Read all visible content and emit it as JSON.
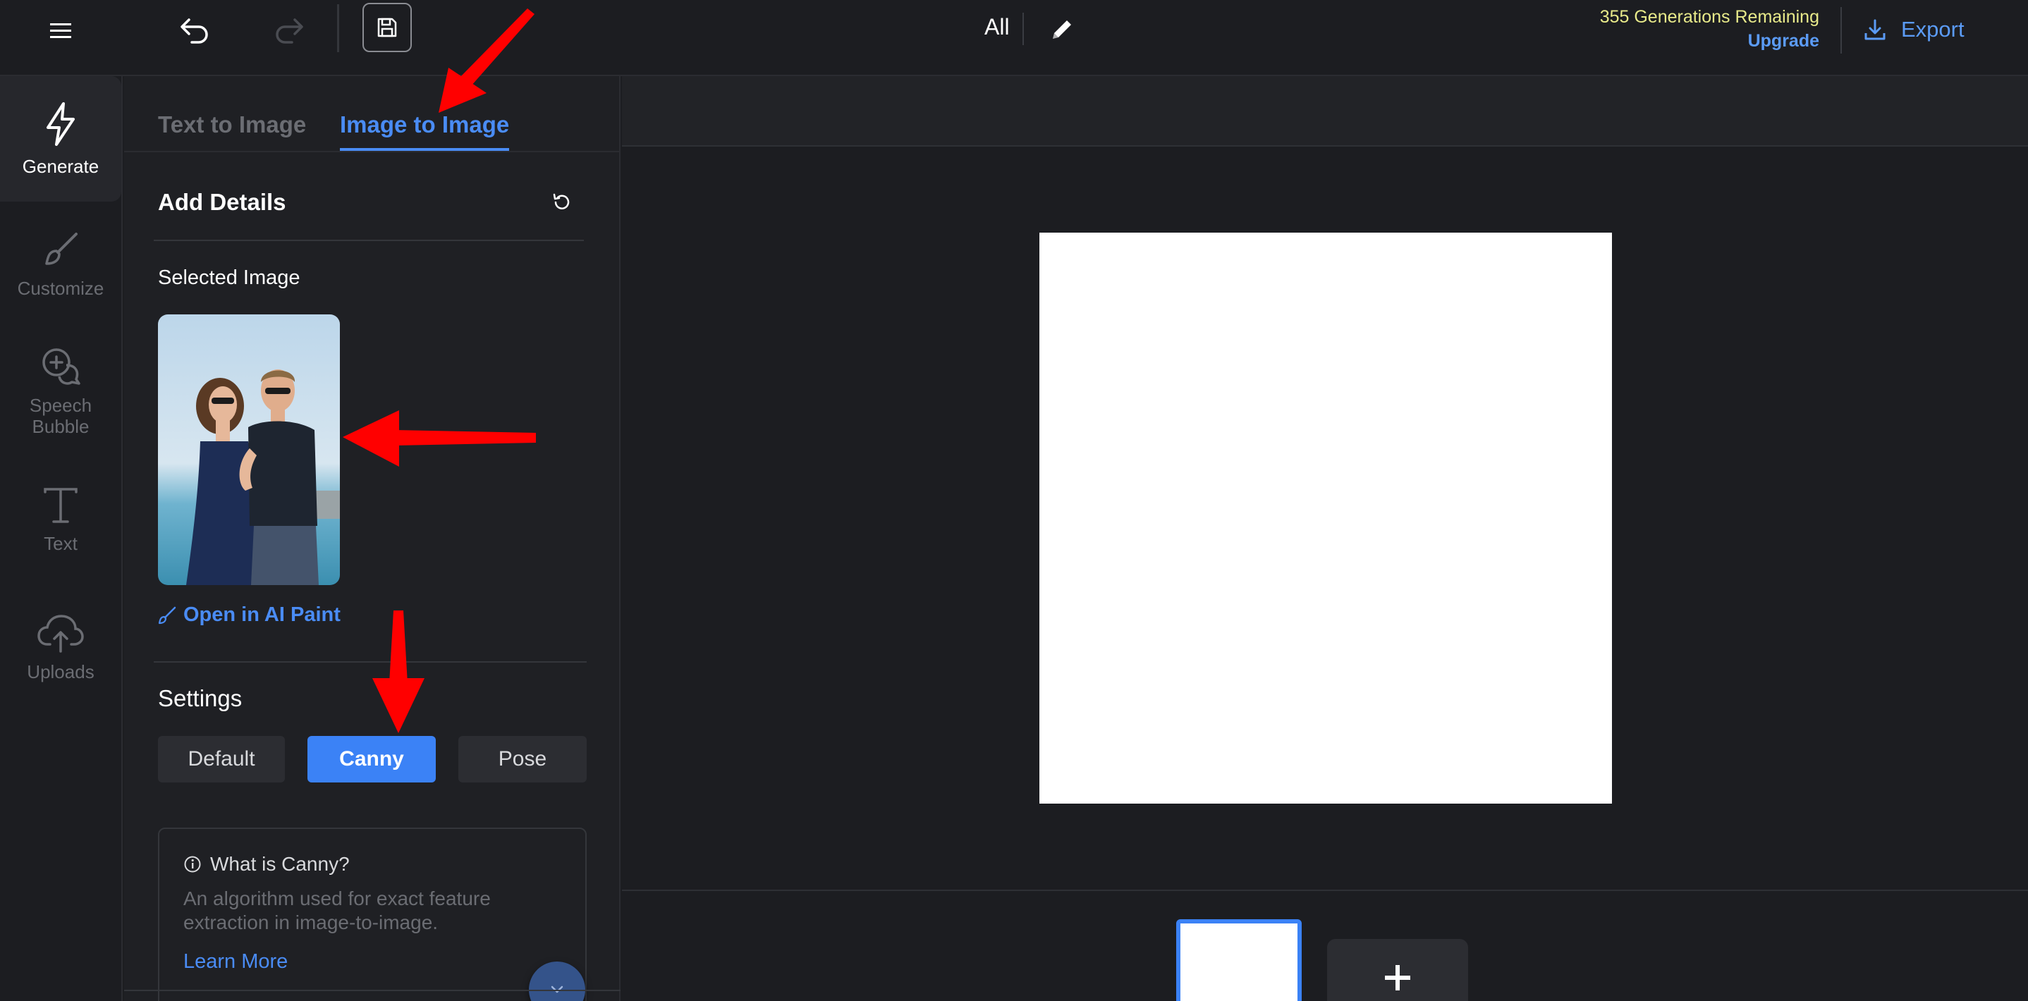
{
  "topbar": {
    "all_label": "All",
    "generations_remaining": "355 Generations Remaining",
    "upgrade_label": "Upgrade",
    "export_label": "Export"
  },
  "leftnav": {
    "items": [
      {
        "label": "Generate",
        "icon": "lightning-icon",
        "active": true
      },
      {
        "label": "Customize",
        "icon": "brush-icon",
        "active": false
      },
      {
        "label": "Speech Bubble",
        "icon": "speech-bubble-icon",
        "active": false
      },
      {
        "label": "Text",
        "icon": "text-icon",
        "active": false
      },
      {
        "label": "Uploads",
        "icon": "cloud-upload-icon",
        "active": false
      }
    ]
  },
  "panel": {
    "tabs": [
      {
        "label": "Text to Image",
        "active": false
      },
      {
        "label": "Image to Image",
        "active": true
      }
    ],
    "section_title": "Add Details",
    "selected_image_label": "Selected Image",
    "open_paint_label": "Open in AI Paint",
    "settings_label": "Settings",
    "settings_options": [
      "Default",
      "Canny",
      "Pose"
    ],
    "settings_selected": "Canny",
    "info": {
      "title": "What is Canny?",
      "description": "An algorithm used for exact feature extraction in image-to-image.",
      "learn_more": "Learn More"
    }
  },
  "colors": {
    "accent": "#3b82f6",
    "link": "#4a8cf5",
    "generations_text": "#e8ea8a",
    "background": "#1c1d21",
    "annotation_arrow": "#ff0000"
  }
}
